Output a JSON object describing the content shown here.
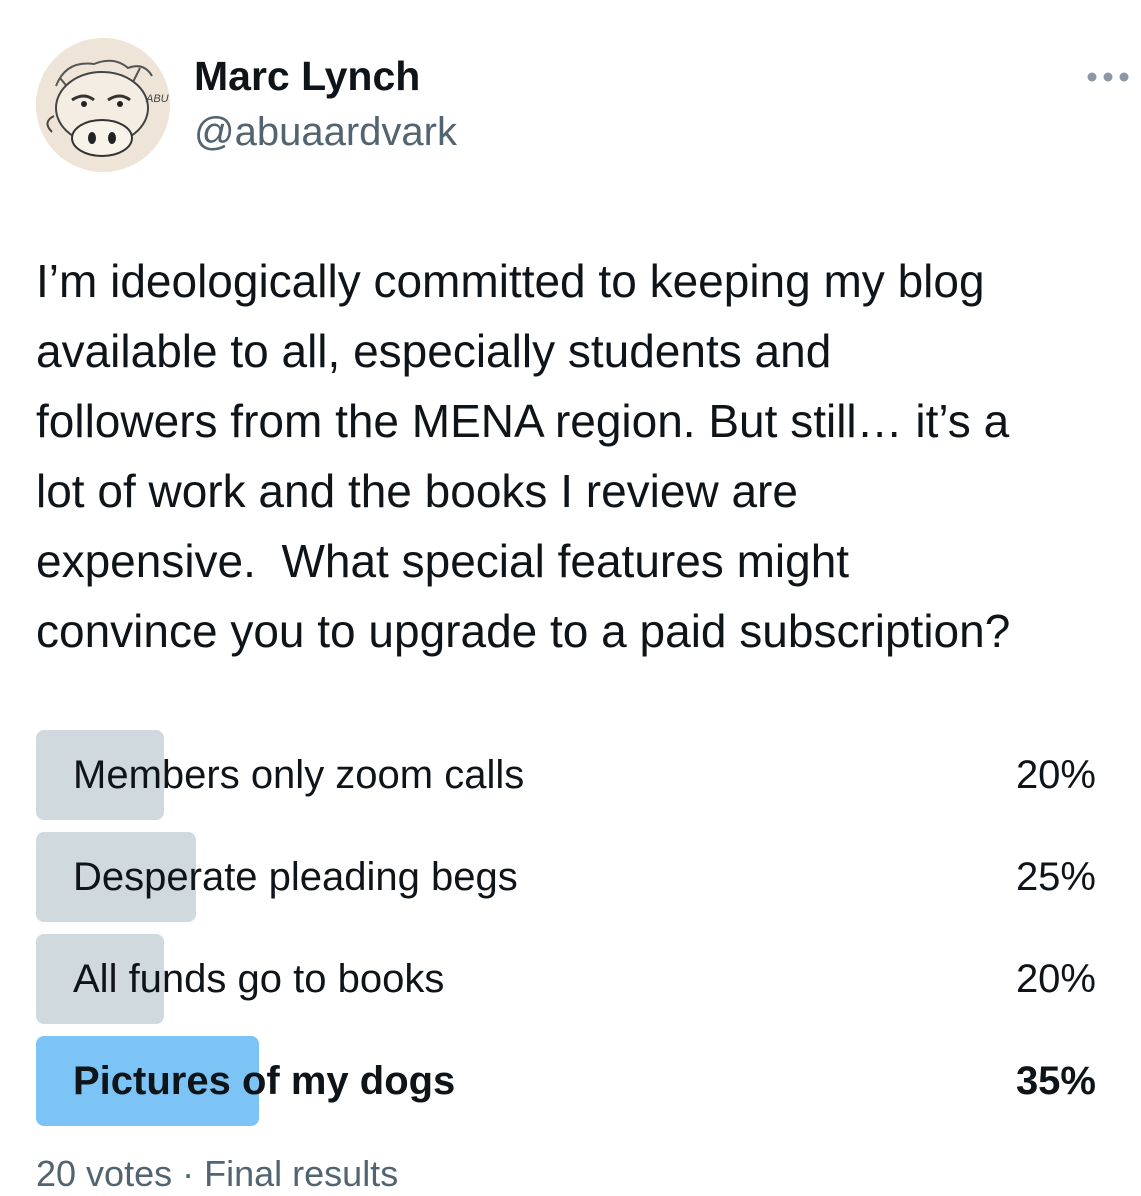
{
  "author": {
    "name": "Marc Lynch",
    "handle": "@abuaardvark",
    "avatar_text": "ABU"
  },
  "tweet": {
    "text": "I’m ideologically committed to keeping my blog\navailable to all, especially students and\nfollowers from the MENA region. But still… it’s a\nlot of work and the books I review are\nexpensive.  What special features might\nconvince you to upgrade to a paid subscription?"
  },
  "poll": {
    "options": [
      {
        "label": "Members only zoom calls",
        "percent_text": "20%",
        "percent": 20,
        "winner": false
      },
      {
        "label": "Desperate pleading begs",
        "percent_text": "25%",
        "percent": 25,
        "winner": false
      },
      {
        "label": "All funds go to books",
        "percent_text": "20%",
        "percent": 20,
        "winner": false
      },
      {
        "label": "Pictures of my dogs",
        "percent_text": "35%",
        "percent": 35,
        "winner": true
      }
    ],
    "votes": "20 votes",
    "separator": "·",
    "status": "Final results"
  },
  "colors": {
    "bar": "#cfd9de",
    "winner_bar": "#7dc4f6",
    "secondary_text": "#536471",
    "primary_text": "#0f1419"
  },
  "icons": {
    "more": "more-horizontal-icon",
    "avatar": "aardvark-cartoon-avatar"
  }
}
